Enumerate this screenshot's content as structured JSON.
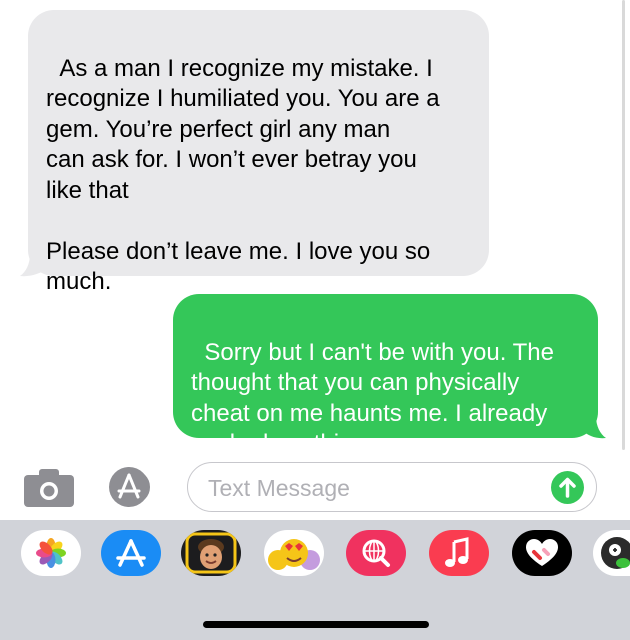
{
  "conversation": {
    "messages": [
      {
        "direction": "incoming",
        "text": "As a man I recognize my mistake. I\nrecognize I humiliated you. You are a\ngem. You’re perfect girl any man\ncan ask for. I won’t ever betray you\nlike that\n\nPlease don’t leave me. I love you so\nmuch."
      },
      {
        "direction": "outgoing",
        "text": "Sorry but I can't be with you. The\nthought that you can physically\ncheat on me haunts me. I already\npacked my things"
      }
    ]
  },
  "compose": {
    "placeholder": "Text Message",
    "camera_icon": "camera-icon",
    "apps_icon": "app-store-icon",
    "send_icon": "arrow-up-icon"
  },
  "app_drawer": {
    "apps": [
      "photos-icon",
      "app-store-icon",
      "memoji-icon",
      "animoji-icon",
      "web-search-icon",
      "music-icon",
      "digital-touch-icon",
      "game-icon"
    ]
  },
  "colors": {
    "incoming_bubble": "#e9e9eb",
    "outgoing_bubble": "#34c759",
    "drawer_background": "#d1d3d9"
  }
}
